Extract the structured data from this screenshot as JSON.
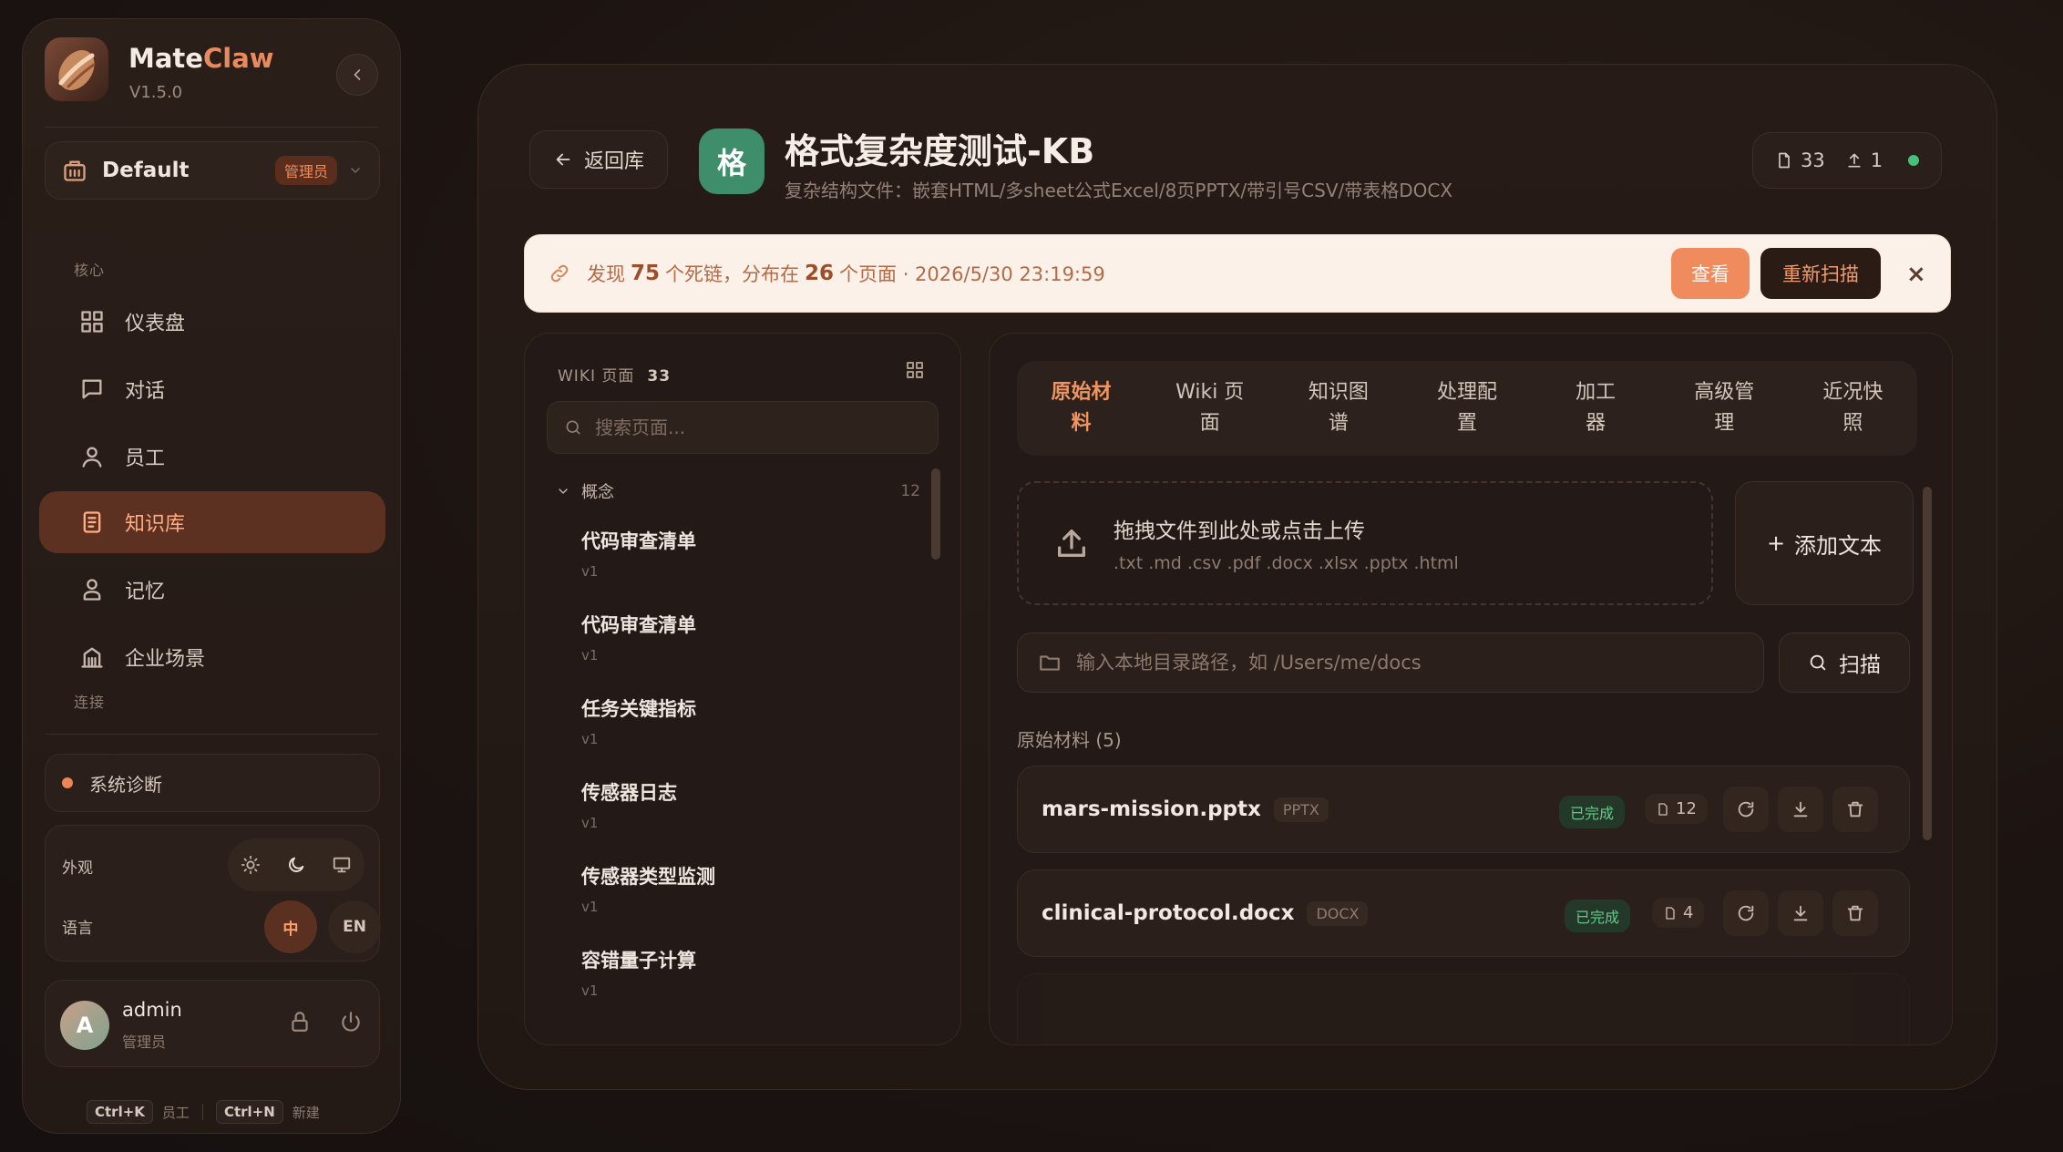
{
  "app": {
    "name_prefix": "Mate",
    "name_accent": "Claw",
    "version": "V1.5.0"
  },
  "workspace": {
    "name": "Default",
    "role_badge": "管理员"
  },
  "sidebar": {
    "section_core": "核心",
    "items": [
      {
        "label": "仪表盘",
        "icon": "dashboard-grid-icon"
      },
      {
        "label": "对话",
        "icon": "chat-bubble-icon"
      },
      {
        "label": "员工",
        "icon": "person-icon"
      },
      {
        "label": "知识库",
        "icon": "book-icon",
        "active": true
      },
      {
        "label": "记忆",
        "icon": "memory-person-icon"
      },
      {
        "label": "企业场景",
        "icon": "building-icon"
      }
    ],
    "section_connect": "连接",
    "system_diag": "系统诊断",
    "appearance_label": "外观",
    "language_label": "语言",
    "lang_zh": "中",
    "lang_en": "EN",
    "user": {
      "avatar_letter": "A",
      "name": "admin",
      "role": "管理员"
    },
    "shortcuts": [
      {
        "keys": "Ctrl+K",
        "label": "员工"
      },
      {
        "keys": "Ctrl+N",
        "label": "新建"
      }
    ]
  },
  "header": {
    "back_label": "返回库",
    "kb_avatar": "格",
    "title": "格式复杂度测试-KB",
    "description": "复杂结构文件：嵌套HTML/多sheet公式Excel/8页PPTX/带引号CSV/带表格DOCX",
    "doc_count": "33",
    "upload_count": "1"
  },
  "alert": {
    "prefix": "发现",
    "dead_links": "75",
    "mid": "个死链，分布在",
    "pages": "26",
    "suffix": "个页面 · 2026/5/30 23:19:59",
    "view_label": "查看",
    "rescan_label": "重新扫描",
    "close": "×"
  },
  "wiki": {
    "header": "WIKI 页面",
    "count": "33",
    "search_placeholder": "搜索页面...",
    "group": {
      "name": "概念",
      "count": "12"
    },
    "items": [
      {
        "title": "代码审查清单",
        "version": "v1"
      },
      {
        "title": "代码审查清单",
        "version": "v1"
      },
      {
        "title": "任务关键指标",
        "version": "v1"
      },
      {
        "title": "传感器日志",
        "version": "v1"
      },
      {
        "title": "传感器类型监测",
        "version": "v1"
      },
      {
        "title": "容错量子计算",
        "version": "v1"
      }
    ]
  },
  "tabs": [
    {
      "line1": "原始材",
      "line2": "料",
      "active": true
    },
    {
      "line1": "Wiki 页",
      "line2": "面"
    },
    {
      "line1": "知识图",
      "line2": "谱"
    },
    {
      "line1": "处理配",
      "line2": "置"
    },
    {
      "line1": "加工",
      "line2": "器"
    },
    {
      "line1": "高级管",
      "line2": "理"
    },
    {
      "line1": "近况快",
      "line2": "照"
    }
  ],
  "upload": {
    "title": "拖拽文件到此处或点击上传",
    "formats": ".txt .md .csv .pdf .docx .xlsx .pptx .html",
    "add_text_label": "添加文本"
  },
  "scan": {
    "path_placeholder": "输入本地目录路径，如 /Users/me/docs",
    "scan_label": "扫描"
  },
  "raw_materials": {
    "label": "原始材料 (5)",
    "files": [
      {
        "name": "mars-mission.pptx",
        "type": "PPTX",
        "status": "已完成",
        "pages": "12"
      },
      {
        "name": "clinical-protocol.docx",
        "type": "DOCX",
        "status": "已完成",
        "pages": "4"
      }
    ]
  },
  "colors": {
    "accent": "#EF8B5D",
    "success": "#47C07B",
    "kb_avatar": "#3F8E6B"
  }
}
